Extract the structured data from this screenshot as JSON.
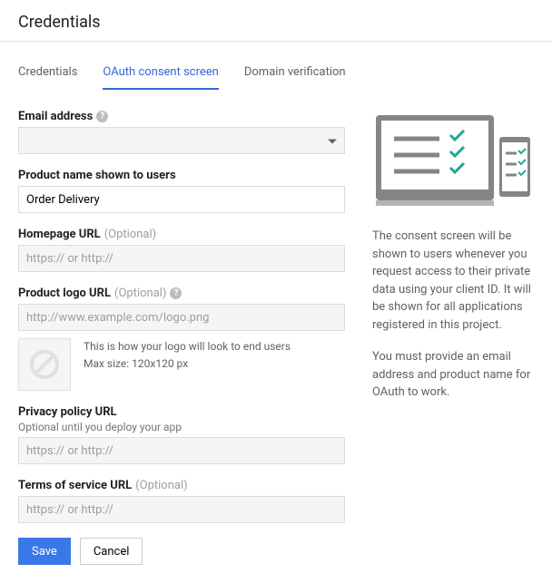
{
  "header": {
    "title": "Credentials"
  },
  "tabs": [
    {
      "label": "Credentials",
      "active": false
    },
    {
      "label": "OAuth consent screen",
      "active": true
    },
    {
      "label": "Domain verification",
      "active": false
    }
  ],
  "fields": {
    "email": {
      "label": "Email address",
      "value": ""
    },
    "product_name": {
      "label": "Product name shown to users",
      "value": "Order Delivery"
    },
    "homepage": {
      "label": "Homepage URL",
      "optional": "(Optional)",
      "placeholder": "https:// or http://"
    },
    "logo_url": {
      "label": "Product logo URL",
      "optional": "(Optional)",
      "placeholder": "http://www.example.com/logo.png"
    },
    "logo_hint": {
      "line1": "This is how your logo will look to end users",
      "line2": "Max size: 120x120 px"
    },
    "privacy": {
      "label": "Privacy policy URL",
      "sub": "Optional until you deploy your app",
      "placeholder": "https:// or http://"
    },
    "tos": {
      "label": "Terms of service URL",
      "optional": "(Optional)",
      "placeholder": "https:// or http://"
    }
  },
  "buttons": {
    "save": "Save",
    "cancel": "Cancel"
  },
  "side": {
    "p1": "The consent screen will be shown to users whenever you request access to their private data using your client ID. It will be shown for all applications registered in this project.",
    "p2": "You must provide an email address and product name for OAuth to work."
  }
}
